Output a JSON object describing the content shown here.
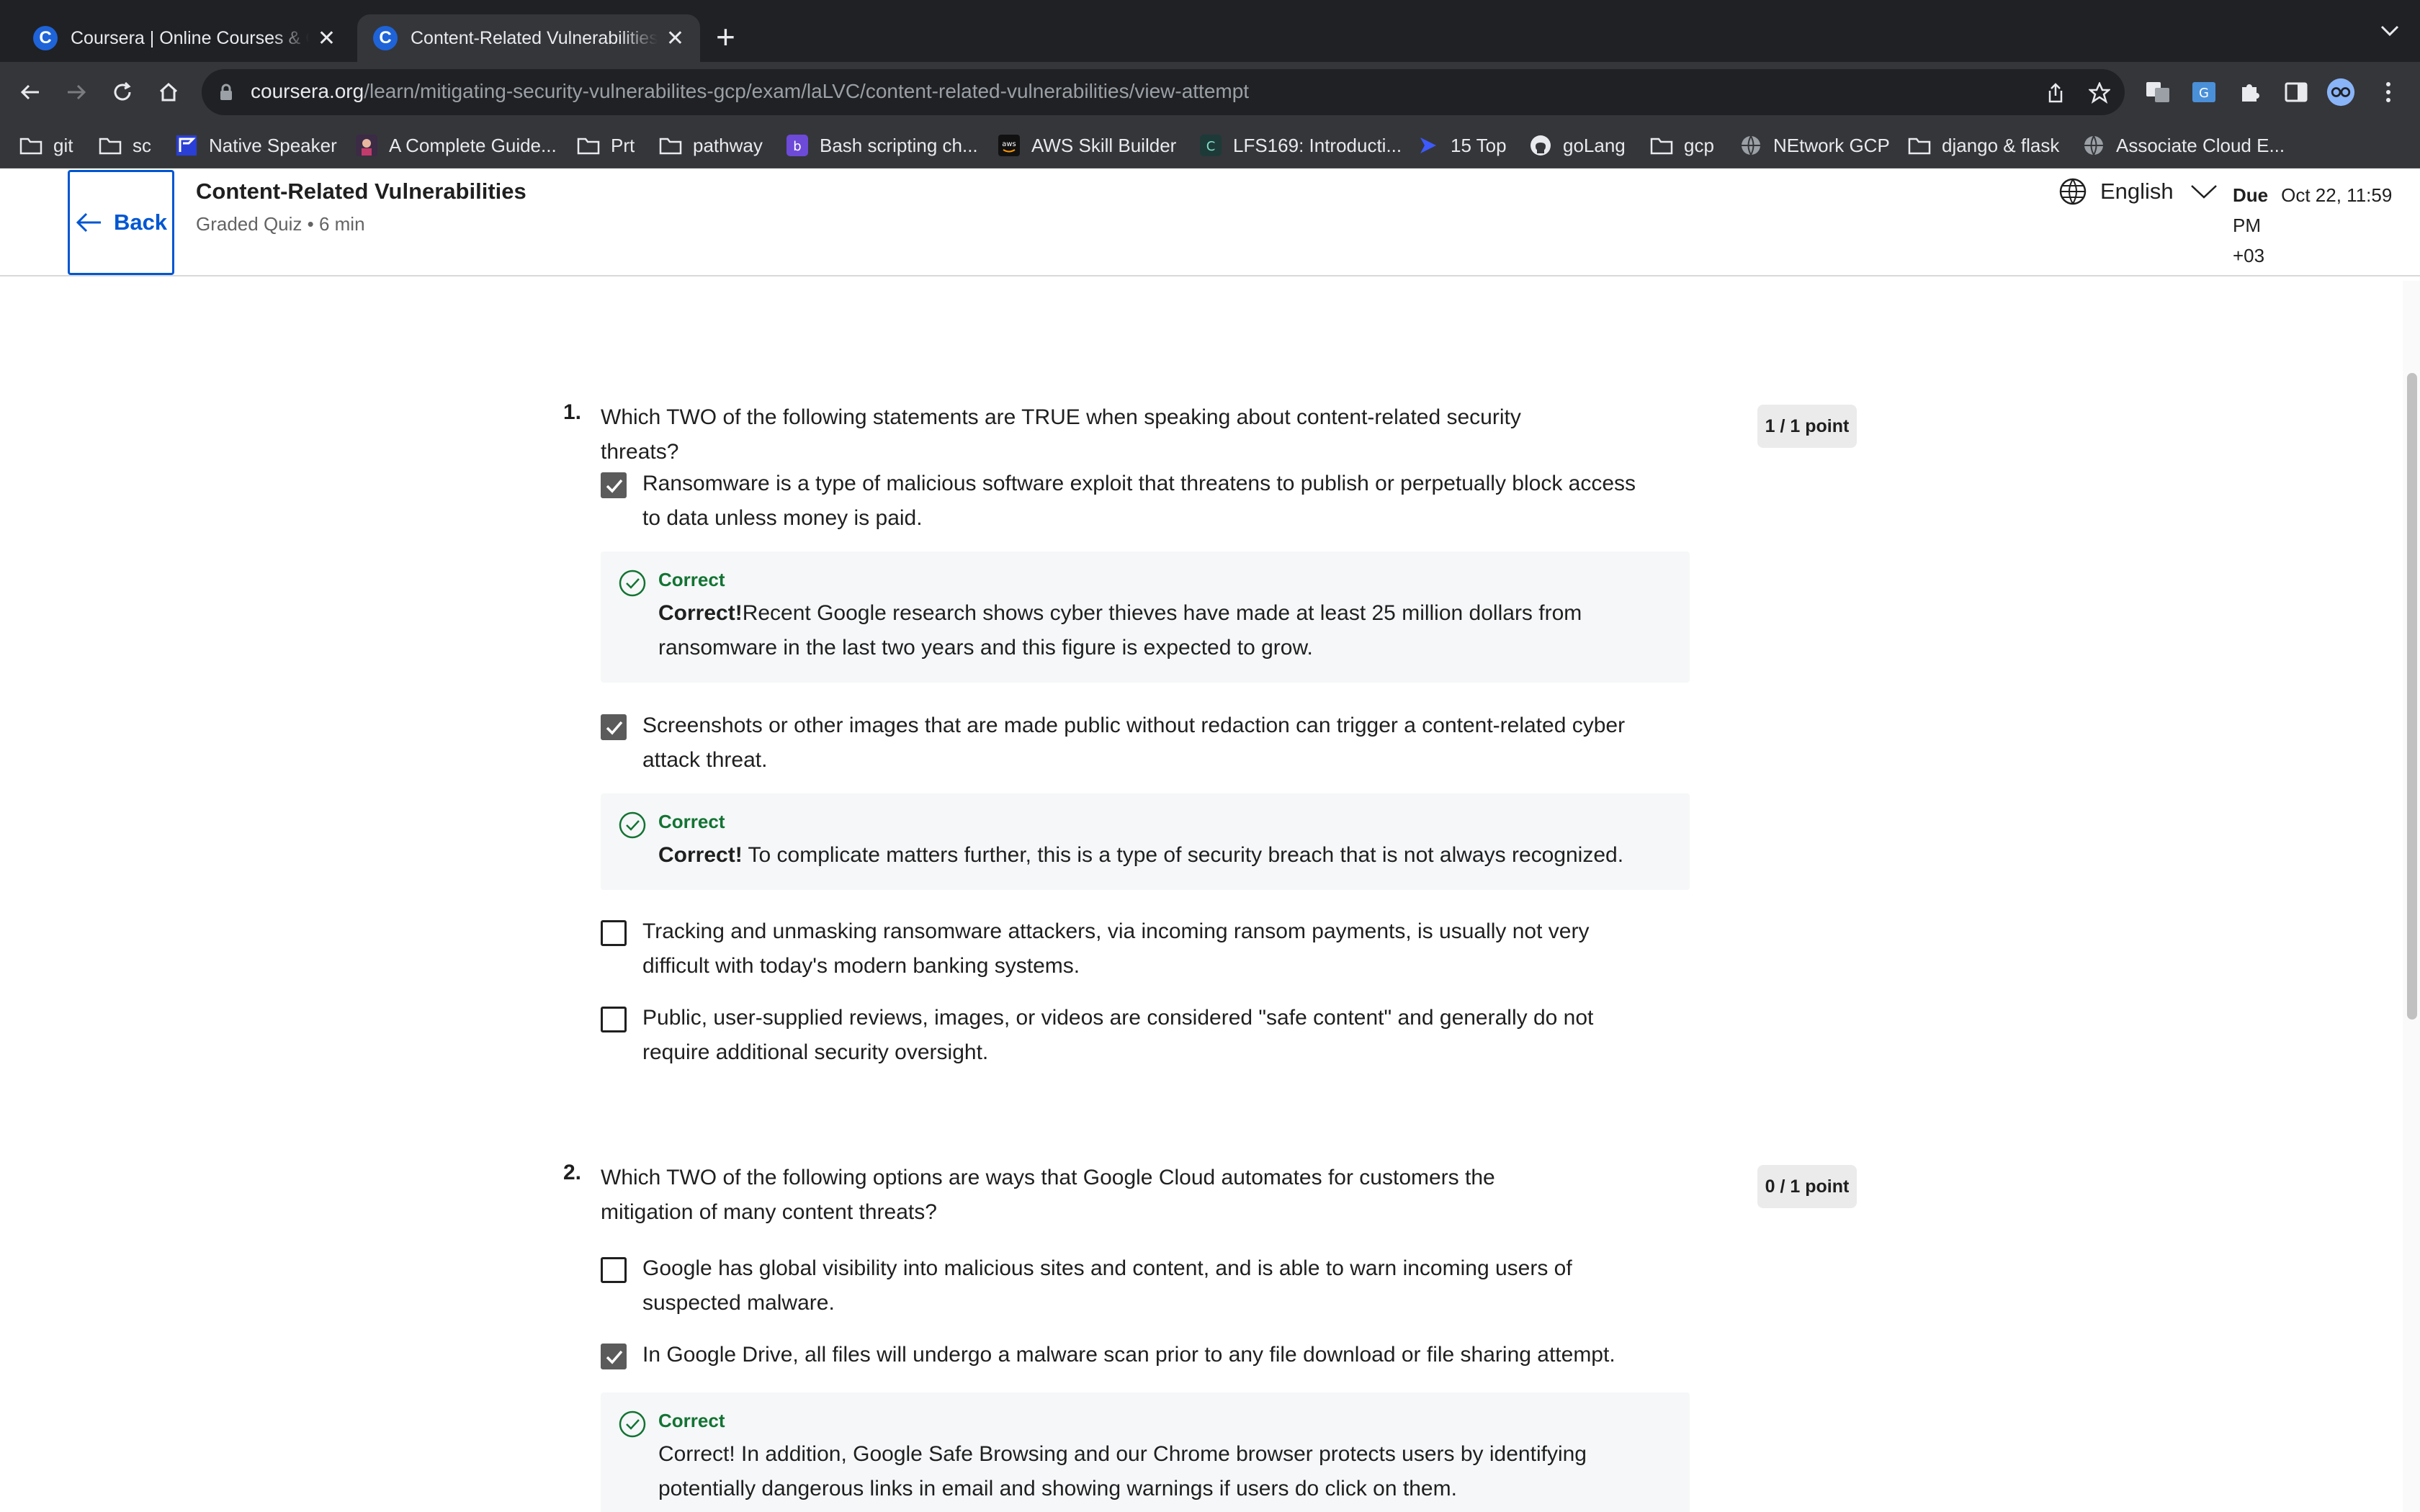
{
  "browser": {
    "tabs": [
      {
        "title": "Coursera | Online Courses & Credentials From Top Educators",
        "favicon": "C",
        "active": false
      },
      {
        "title": "Content-Related Vulnerabilities",
        "favicon": "C",
        "active": true
      }
    ],
    "url_host": "coursera.org",
    "url_path": "/learn/mitigating-security-vulnerabilites-gcp/exam/laLVC/content-related-vulnerabilities/view-attempt",
    "bookmarks": [
      {
        "label": "git",
        "icon": "folder-icon"
      },
      {
        "label": "sc",
        "icon": "folder-icon"
      },
      {
        "label": "Native Speaker",
        "icon": "flag-icon"
      },
      {
        "label": "A Complete Guide...",
        "icon": "avatar-icon"
      },
      {
        "label": "Prt",
        "icon": "folder-icon"
      },
      {
        "label": "pathway",
        "icon": "folder-icon"
      },
      {
        "label": "Bash scripting ch...",
        "icon": "bash-icon"
      },
      {
        "label": "AWS Skill Builder",
        "icon": "aws-icon"
      },
      {
        "label": "LFS169: Introducti...",
        "icon": "course-icon"
      },
      {
        "label": "15 Top",
        "icon": "arrow-icon"
      },
      {
        "label": "goLang",
        "icon": "github-icon"
      },
      {
        "label": "gcp",
        "icon": "folder-icon"
      },
      {
        "label": "NEtwork GCP",
        "icon": "globe-icon"
      },
      {
        "label": "django & flask",
        "icon": "folder-icon"
      },
      {
        "label": "Associate Cloud E...",
        "icon": "globe-icon"
      }
    ]
  },
  "header": {
    "back_label": "Back",
    "title": "Content-Related Vulnerabilities",
    "subtitle": "Graded Quiz • 6 min",
    "language": "English",
    "due_label": "Due",
    "due_date": "Oct 22, 11:59 PM",
    "due_tz": "+03"
  },
  "questions": [
    {
      "number": "1.",
      "text": "Which TWO of the following statements are TRUE when speaking about content-related security threats?",
      "points": "1 / 1 point",
      "options": [
        {
          "text": "Ransomware is a type of malicious software exploit that threatens to publish or perpetually block access to data unless money is paid.",
          "checked": true,
          "feedback": {
            "label": "Correct",
            "bold": "Correct!",
            "text": "Recent Google research shows cyber thieves have made at least 25 million dollars from ransomware in the last two years and this figure is expected to grow."
          }
        },
        {
          "text": "Screenshots or other images that are made public without redaction can trigger a content-related cyber attack threat.",
          "checked": true,
          "feedback": {
            "label": "Correct",
            "bold": "Correct!",
            "text": " To complicate matters further, this is a type of security breach that is not always recognized."
          }
        },
        {
          "text": "Tracking and unmasking ransomware attackers, via incoming ransom payments, is usually not very difficult with today's modern banking systems.",
          "checked": false
        },
        {
          "text": "Public, user-supplied reviews, images, or videos are considered \"safe content\" and generally do not require additional security oversight.",
          "checked": false
        }
      ]
    },
    {
      "number": "2.",
      "text": "Which TWO of the following options are ways that Google Cloud automates for customers the mitigation of many content threats?",
      "points": "0 / 1 point",
      "options": [
        {
          "text": "Google has global visibility into malicious sites and content, and is able to warn incoming users of suspected malware.",
          "checked": false
        },
        {
          "text": "In Google Drive, all files will undergo a malware scan prior to any file download or file sharing attempt.",
          "checked": true,
          "feedback": {
            "label": "Correct",
            "bold": "",
            "text": "Correct! In addition, Google Safe Browsing and our Chrome browser protects users by identifying potentially dangerous links in email and showing warnings if users do click on them."
          }
        }
      ]
    }
  ],
  "colors": {
    "accent": "#0056d2",
    "correct": "#137333",
    "chrome_dark": "#202124",
    "chrome_toolbar": "#35363a"
  }
}
